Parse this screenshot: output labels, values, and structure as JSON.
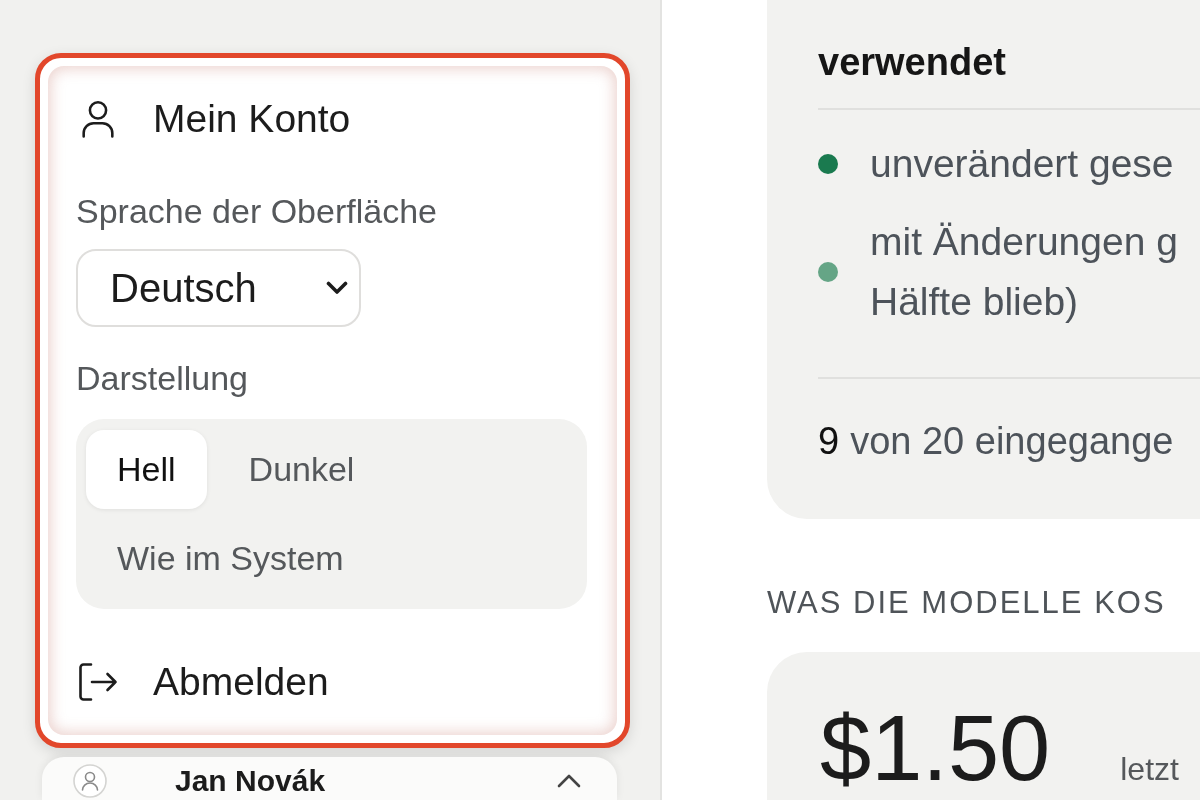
{
  "account_menu": {
    "highlighted": true,
    "title": "Mein Konto",
    "language": {
      "label": "Sprache der Oberfläche",
      "value": "Deutsch"
    },
    "appearance": {
      "label": "Darstellung",
      "options": [
        {
          "label": "Hell",
          "selected": true
        },
        {
          "label": "Dunkel",
          "selected": false
        },
        {
          "label": "Wie im System",
          "selected": false
        }
      ]
    },
    "logout": "Abmelden"
  },
  "user_card": {
    "name": "Jan Novák"
  },
  "usage_card": {
    "heading": "verwendet",
    "items": [
      {
        "text_lines": [
          "unverändert gese"
        ],
        "color": "#1a7a4f"
      },
      {
        "text_lines": [
          "mit Änderungen g",
          "Hälfte blieb)"
        ],
        "color": "#65a586"
      }
    ],
    "count": "9",
    "count_text": "von 20 eingegange"
  },
  "costs": {
    "heading": "WAS DIE MODELLE KOS",
    "amount": "$1.50",
    "caption": "letzt"
  }
}
